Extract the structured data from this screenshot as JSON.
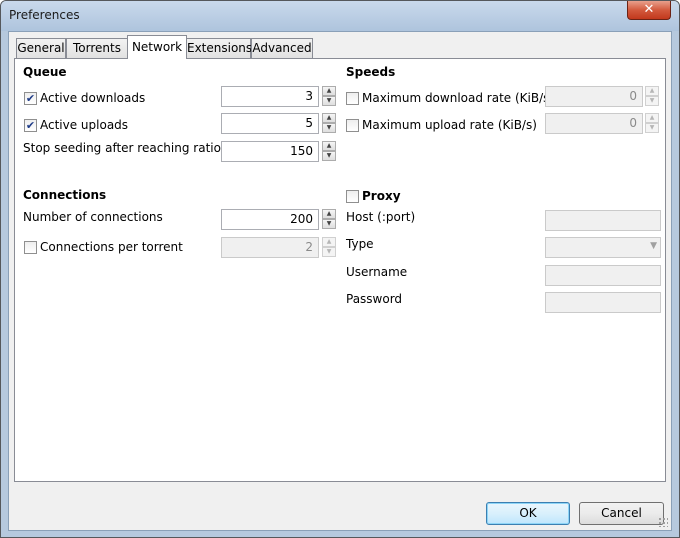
{
  "window": {
    "title": "Preferences",
    "close_glyph": "✕"
  },
  "tabs": [
    {
      "label": "General",
      "active": false
    },
    {
      "label": "Torrents",
      "active": false
    },
    {
      "label": "Network",
      "active": true
    },
    {
      "label": "Extensions",
      "active": false
    },
    {
      "label": "Advanced",
      "active": false
    }
  ],
  "queue": {
    "heading": "Queue",
    "active_downloads": {
      "label": "Active downloads",
      "checked": true,
      "value": "3"
    },
    "active_uploads": {
      "label": "Active uploads",
      "checked": true,
      "value": "5"
    },
    "stop_seeding": {
      "label": "Stop seeding after reaching ratio (%)",
      "value": "150"
    }
  },
  "speeds": {
    "heading": "Speeds",
    "max_download": {
      "label": "Maximum download rate (KiB/s)",
      "checked": false,
      "value": "0"
    },
    "max_upload": {
      "label": "Maximum upload rate (KiB/s)",
      "checked": false,
      "value": "0"
    }
  },
  "connections": {
    "heading": "Connections",
    "number": {
      "label": "Number of connections",
      "value": "200"
    },
    "per_torrent": {
      "label": "Connections per torrent",
      "checked": false,
      "value": "2"
    }
  },
  "proxy": {
    "label": "Proxy",
    "checked": false,
    "host_label": "Host (:port)",
    "type_label": "Type",
    "username_label": "Username",
    "password_label": "Password"
  },
  "buttons": {
    "ok": "OK",
    "cancel": "Cancel"
  }
}
